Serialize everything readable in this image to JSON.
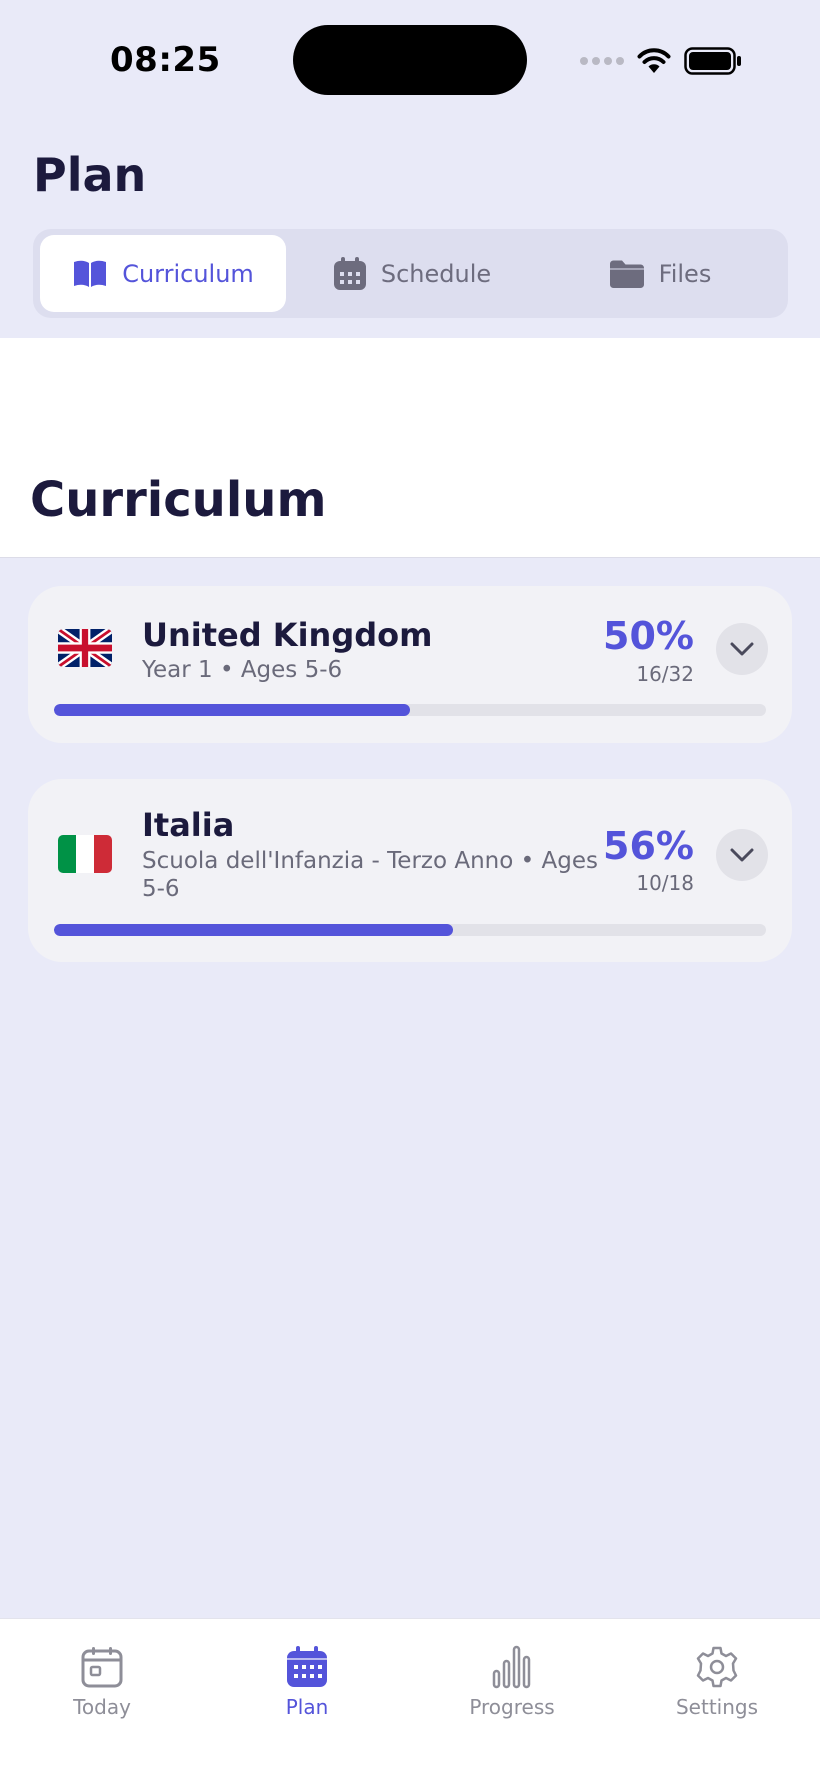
{
  "status_bar": {
    "time": "08:25"
  },
  "page": {
    "title": "Plan"
  },
  "segments": [
    {
      "label": "Curriculum",
      "icon": "book-icon",
      "active": true
    },
    {
      "label": "Schedule",
      "icon": "calendar-icon",
      "active": false
    },
    {
      "label": "Files",
      "icon": "folder-icon",
      "active": false
    }
  ],
  "section": {
    "title": "Curriculum"
  },
  "curricula": [
    {
      "flag": "united-kingdom-flag",
      "name": "United Kingdom",
      "subtitle": "Year 1 • Ages 5-6",
      "percent_label": "50%",
      "count_label": "16/32",
      "progress": 0.5
    },
    {
      "flag": "italy-flag",
      "name": "Italia",
      "subtitle": "Scuola dell'Infanzia - Terzo Anno • Ages 5-6",
      "percent_label": "56%",
      "count_label": "10/18",
      "progress": 0.56
    }
  ],
  "tabs": [
    {
      "label": "Today",
      "icon": "today-icon",
      "active": false
    },
    {
      "label": "Plan",
      "icon": "calendar-icon",
      "active": true
    },
    {
      "label": "Progress",
      "icon": "bar-chart-icon",
      "active": false
    },
    {
      "label": "Settings",
      "icon": "gear-icon",
      "active": false
    }
  ],
  "colors": {
    "accent": "#5454DA",
    "background": "#E9EAF8",
    "card": "#F2F2F6",
    "text_primary": "#1C1A3D",
    "text_secondary": "#6A6A7A"
  }
}
